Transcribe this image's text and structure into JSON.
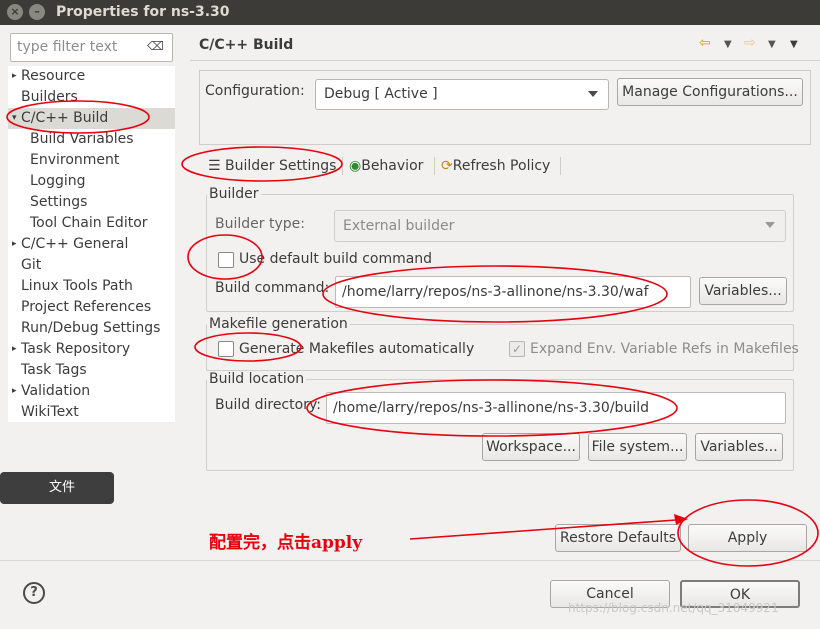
{
  "window": {
    "title": "Properties for ns-3.30",
    "close_glyph": "×",
    "minimize_glyph": "–"
  },
  "sidebar": {
    "filter_placeholder": "type filter text",
    "filter_clear_glyph": "⌫",
    "items": [
      {
        "label": "Resource",
        "twisty": "▸"
      },
      {
        "label": "Builders"
      },
      {
        "label": "C/C++ Build",
        "twisty": "▾",
        "selected": true
      },
      {
        "label": "Build Variables"
      },
      {
        "label": "Environment"
      },
      {
        "label": "Logging"
      },
      {
        "label": "Settings"
      },
      {
        "label": "Tool Chain Editor"
      },
      {
        "label": "C/C++ General",
        "twisty": "▸"
      },
      {
        "label": "Git"
      },
      {
        "label": "Linux Tools Path"
      },
      {
        "label": "Project References"
      },
      {
        "label": "Run/Debug Settings"
      },
      {
        "label": "Task Repository",
        "twisty": "▸"
      },
      {
        "label": "Task Tags"
      },
      {
        "label": "Validation",
        "twisty": "▸"
      },
      {
        "label": "WikiText"
      }
    ]
  },
  "header": {
    "title": "C/C++ Build",
    "back_icon": "⇦",
    "forward_icon": "⇨",
    "dropdown_glyph": "▼"
  },
  "configuration": {
    "label": "Configuration:",
    "value": "Debug  [ Active ]",
    "manage_label": "Manage Configurations..."
  },
  "tabs": [
    {
      "label": "Builder Settings",
      "icon": "☰"
    },
    {
      "label": "Behavior",
      "icon": "◉"
    },
    {
      "label": "Refresh Policy",
      "icon": "⟳"
    }
  ],
  "builder": {
    "legend": "Builder",
    "type_label": "Builder type:",
    "type_value": "External builder",
    "use_default_label": "Use default build command",
    "use_default_checked": false,
    "command_label": "Build command:",
    "command_value": "/home/larry/repos/ns-3-allinone/ns-3.30/waf",
    "variables_label": "Variables..."
  },
  "makefile": {
    "legend": "Makefile generation",
    "generate_label": "Generate Makefiles automatically",
    "generate_checked": false,
    "expand_label": "Expand Env. Variable Refs in Makefiles",
    "expand_checked": true,
    "expand_check_glyph": "✓"
  },
  "location": {
    "legend": "Build location",
    "dir_label": "Build directory:",
    "dir_value": "/home/larry/repos/ns-3-allinone/ns-3.30/build",
    "workspace_label": "Workspace...",
    "filesystem_label": "File system...",
    "variables_label": "Variables..."
  },
  "footer": {
    "restore_label": "Restore Defaults",
    "apply_label": "Apply",
    "cancel_label": "Cancel",
    "ok_label": "OK",
    "help_glyph": "?"
  },
  "tooltip": {
    "text": "文件"
  },
  "annotation": {
    "text": "配置完，点击apply",
    "color": "#e8000e"
  },
  "watermark": "https://blog.csdn.net/qq_31849921"
}
